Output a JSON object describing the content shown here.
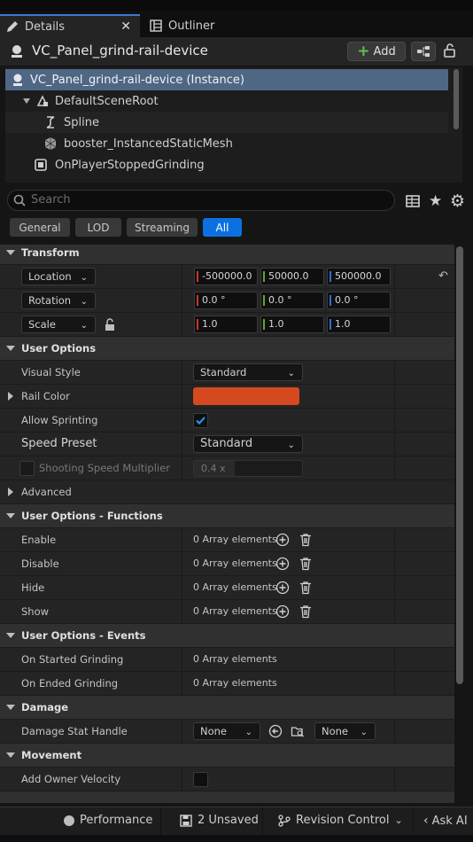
{
  "tabs": {
    "details": "Details",
    "outliner": "Outliner"
  },
  "header": {
    "title": "VC_Panel_grind-rail-device",
    "add_label": "Add"
  },
  "tree": {
    "rows": [
      "VC_Panel_grind-rail-device (Instance)",
      "DefaultSceneRoot",
      "Spline",
      "booster_InstancedStaticMesh",
      "OnPlayerStoppedGrinding"
    ]
  },
  "search": {
    "placeholder": "Search"
  },
  "filters": [
    "General",
    "LOD",
    "Streaming",
    "All"
  ],
  "transform": {
    "category": "Transform",
    "location_label": "Location",
    "rotation_label": "Rotation",
    "scale_label": "Scale",
    "location": [
      "-500000.0",
      "50000.0",
      "500000.0"
    ],
    "rotation": [
      "0.0 °",
      "0.0 °",
      "0.0 °"
    ],
    "scale": [
      "1.0",
      "1.0",
      "1.0"
    ]
  },
  "user_options": {
    "category": "User Options",
    "visual_style_label": "Visual Style",
    "visual_style_value": "Standard",
    "rail_color_label": "Rail Color",
    "rail_color": "#d44a1e",
    "allow_sprinting_label": "Allow Sprinting",
    "allow_sprinting": true,
    "speed_preset_label": "Speed Preset",
    "speed_preset_value": "Standard",
    "shooting_speed_label": "Shooting Speed Multiplier",
    "shooting_speed_value": "0.4 x",
    "advanced_label": "Advanced"
  },
  "functions": {
    "category": "User Options - Functions",
    "rows": [
      {
        "label": "Enable",
        "value": "0 Array elements"
      },
      {
        "label": "Disable",
        "value": "0 Array elements"
      },
      {
        "label": "Hide",
        "value": "0 Array elements"
      },
      {
        "label": "Show",
        "value": "0 Array elements"
      }
    ]
  },
  "events": {
    "category": "User Options - Events",
    "rows": [
      {
        "label": "On Started Grinding",
        "value": "0 Array elements"
      },
      {
        "label": "On Ended Grinding",
        "value": "0 Array elements"
      }
    ]
  },
  "damage": {
    "category": "Damage",
    "stat_handle_label": "Damage Stat Handle",
    "stat_handle_value": "None",
    "second_value": "None"
  },
  "movement": {
    "category": "Movement",
    "add_owner_velocity_label": "Add Owner Velocity"
  },
  "footer": {
    "performance": "Performance",
    "unsaved": "2 Unsaved",
    "revision": "Revision Control",
    "ask_ai": "Ask AI"
  },
  "colors": {
    "accent": "#0d70e0",
    "x_axis": "#c8352c",
    "y_axis": "#6aa22c",
    "z_axis": "#2f6fd0"
  }
}
